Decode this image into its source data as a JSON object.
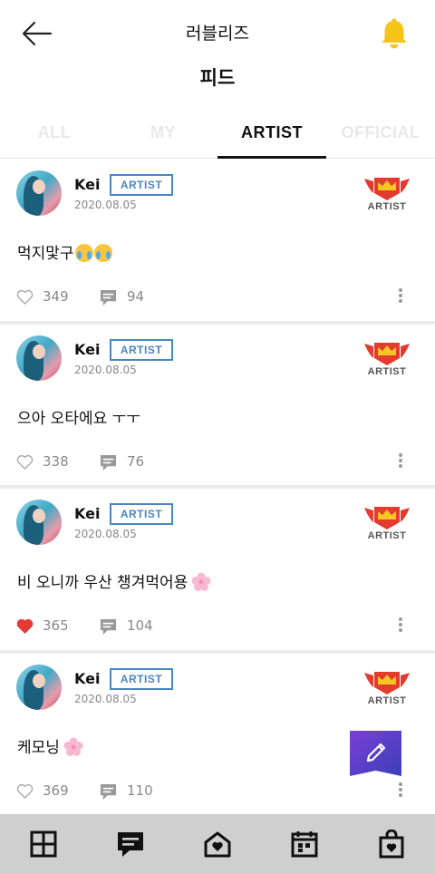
{
  "header": {
    "app_title": "러블리즈",
    "page_title": "피드"
  },
  "tabs": [
    {
      "label": "ALL",
      "active": false
    },
    {
      "label": "MY",
      "active": false
    },
    {
      "label": "ARTIST",
      "active": true
    },
    {
      "label": "OFFICIAL",
      "active": false
    }
  ],
  "posts": [
    {
      "username": "Kei",
      "tag": "ARTIST",
      "date": "2020.08.05",
      "emblem_label": "ARTIST",
      "text": "먹지맟구",
      "liked": false,
      "likes": "349",
      "comments": "94"
    },
    {
      "username": "Kei",
      "tag": "ARTIST",
      "date": "2020.08.05",
      "emblem_label": "ARTIST",
      "text": "으아 오타에요 ㅜㅜ",
      "liked": false,
      "likes": "338",
      "comments": "76"
    },
    {
      "username": "Kei",
      "tag": "ARTIST",
      "date": "2020.08.05",
      "emblem_label": "ARTIST",
      "text": "비 오니까 우산 챙겨먹어용",
      "liked": true,
      "likes": "365",
      "comments": "104"
    },
    {
      "username": "Kei",
      "tag": "ARTIST",
      "date": "2020.08.05",
      "emblem_label": "ARTIST",
      "text": "케모닝",
      "liked": false,
      "likes": "369",
      "comments": "110"
    }
  ],
  "colors": {
    "accent_blue": "#4a86c0",
    "bell_yellow": "#f5c518",
    "like_red": "#e53935",
    "emblem_red": "#e33b2e",
    "fab_purple": "#5b3fc4",
    "bottom_bar": "#cfcfcf"
  },
  "icons": {
    "back": "arrow-left-icon",
    "notifications": "bell-icon",
    "compose": "pencil-icon",
    "like": "heart-icon",
    "comment": "comment-icon",
    "more": "more-vertical-icon",
    "nav": [
      "grid-icon",
      "feed-icon",
      "home-heart-icon",
      "calendar-icon",
      "shop-bag-icon"
    ]
  }
}
